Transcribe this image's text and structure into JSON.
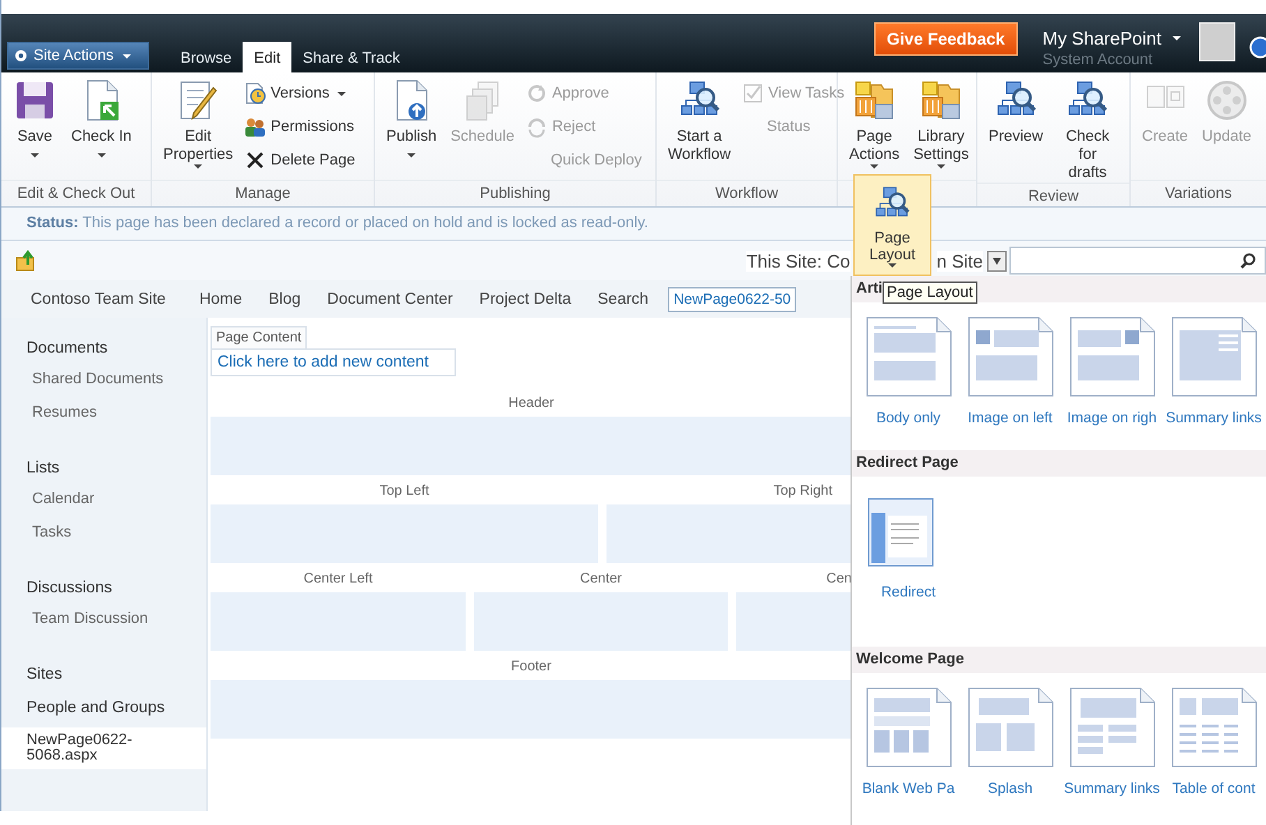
{
  "top_bar": {
    "site_actions": "Site Actions",
    "tabs": [
      {
        "label": "Browse",
        "selected": false
      },
      {
        "label": "Edit",
        "selected": true
      },
      {
        "label": "Share & Track",
        "selected": false
      }
    ],
    "feedback": "Give Feedback",
    "user_menu": "My SharePoint",
    "account": "System Account"
  },
  "ribbon": {
    "groups": [
      {
        "label": "Edit & Check Out",
        "controls": [
          {
            "kind": "large",
            "label": "Save",
            "dropdown": true,
            "disabled": false
          },
          {
            "kind": "large",
            "label": "Check In",
            "dropdown": true,
            "disabled": false
          }
        ]
      },
      {
        "label": "Manage",
        "controls": [
          {
            "kind": "large",
            "label": "Edit\nProperties",
            "dropdown": true,
            "disabled": false
          },
          {
            "kind": "stack",
            "items": [
              {
                "label": "Versions",
                "dropdown": true,
                "disabled": false
              },
              {
                "label": "Permissions",
                "dropdown": false,
                "disabled": false
              },
              {
                "label": "Delete Page",
                "dropdown": false,
                "disabled": false
              }
            ]
          }
        ]
      },
      {
        "label": "Publishing",
        "controls": [
          {
            "kind": "large",
            "label": "Publish",
            "dropdown": true,
            "disabled": false
          },
          {
            "kind": "large",
            "label": "Schedule",
            "dropdown": false,
            "disabled": true
          },
          {
            "kind": "stack",
            "items": [
              {
                "label": "Approve",
                "dropdown": false,
                "disabled": true
              },
              {
                "label": "Reject",
                "dropdown": false,
                "disabled": true
              },
              {
                "label": "Quick Deploy",
                "dropdown": false,
                "disabled": true
              }
            ]
          }
        ]
      },
      {
        "label": "Workflow",
        "controls": [
          {
            "kind": "large",
            "label": "Start a\nWorkflow",
            "dropdown": false,
            "disabled": false
          },
          {
            "kind": "stack",
            "items": [
              {
                "label": "View Tasks",
                "dropdown": false,
                "disabled": true
              },
              {
                "label": "Status",
                "dropdown": false,
                "disabled": true
              }
            ]
          }
        ]
      },
      {
        "controls": [
          {
            "kind": "large",
            "label": "Page\nActions",
            "dropdown": true,
            "disabled": false
          },
          {
            "kind": "large",
            "label": "Library\nSettings",
            "dropdown": true,
            "disabled": false
          }
        ]
      },
      {
        "label": "Review",
        "controls": [
          {
            "kind": "large",
            "label": "Preview",
            "dropdown": false,
            "disabled": false
          },
          {
            "kind": "large",
            "label": "Check for\ndrafts",
            "dropdown": false,
            "disabled": false
          }
        ]
      },
      {
        "label": "Variations",
        "controls": [
          {
            "kind": "large",
            "label": "Create",
            "dropdown": false,
            "disabled": true
          },
          {
            "kind": "large",
            "label": "Update",
            "dropdown": false,
            "disabled": true
          }
        ]
      }
    ]
  },
  "status_bar": {
    "text": "**Status:** This page has been declared a record or placed on hold and is locked as read-only."
  },
  "search_row": {
    "scope_left": "This Site: Co",
    "scope_right": "n Site"
  },
  "page_layout_button": {
    "label": "Page\nLayout",
    "dropdown": true,
    "tooltip": "Page Layout"
  },
  "top_nav": {
    "site_title": "Contoso Team Site",
    "items": [
      {
        "label": "Home",
        "selected": false
      },
      {
        "label": "Blog",
        "selected": false
      },
      {
        "label": "Document Center",
        "selected": false
      },
      {
        "label": "Project Delta",
        "selected": false
      },
      {
        "label": "Search",
        "selected": false
      },
      {
        "label": "NewPage0622-50",
        "selected": true
      }
    ]
  },
  "quick_launch": {
    "sections": [
      {
        "heading": "Documents",
        "children": [
          {
            "label": "Shared Documents"
          },
          {
            "label": "Resumes"
          }
        ]
      },
      {
        "heading": "Lists",
        "children": [
          {
            "label": "Calendar"
          },
          {
            "label": "Tasks"
          }
        ]
      },
      {
        "heading": "Discussions",
        "children": [
          {
            "label": "Team Discussion"
          }
        ]
      },
      {
        "heading": "Sites"
      },
      {
        "heading": "People and Groups"
      }
    ],
    "current_page": {
      "label": "NewPage0622-5068.aspx",
      "selected": true
    }
  },
  "content": {
    "page_content_tab": "Page Content",
    "add_content_link": "Click here to add new content",
    "zone_rows": [
      [
        {
          "label": "Header"
        }
      ],
      [
        {
          "label": "Top Left"
        },
        {
          "label": "Top Right"
        }
      ],
      [
        {
          "label": "Center Left"
        },
        {
          "label": "Center"
        },
        {
          "label": "Cen"
        }
      ],
      [
        {
          "label": "Footer"
        }
      ]
    ]
  },
  "layout_menu": {
    "sections": [
      {
        "title": "Arti",
        "items": [
          {
            "kind": "body",
            "label": "Body only"
          },
          {
            "kind": "imgleft",
            "label": "Image on left"
          },
          {
            "kind": "imgright",
            "label": "Image on righ"
          },
          {
            "kind": "summary",
            "label": "Summary links"
          }
        ]
      },
      {
        "title": "Redirect Page",
        "items": [
          {
            "kind": "redirect",
            "label": "Redirect"
          }
        ]
      },
      {
        "title": "Welcome Page",
        "items": [
          {
            "kind": "blank",
            "label": "Blank Web Pa"
          },
          {
            "kind": "splash",
            "label": "Splash"
          },
          {
            "kind": "sumlinks",
            "label": "Summary links"
          },
          {
            "kind": "toc",
            "label": "Table of cont"
          }
        ]
      }
    ]
  }
}
